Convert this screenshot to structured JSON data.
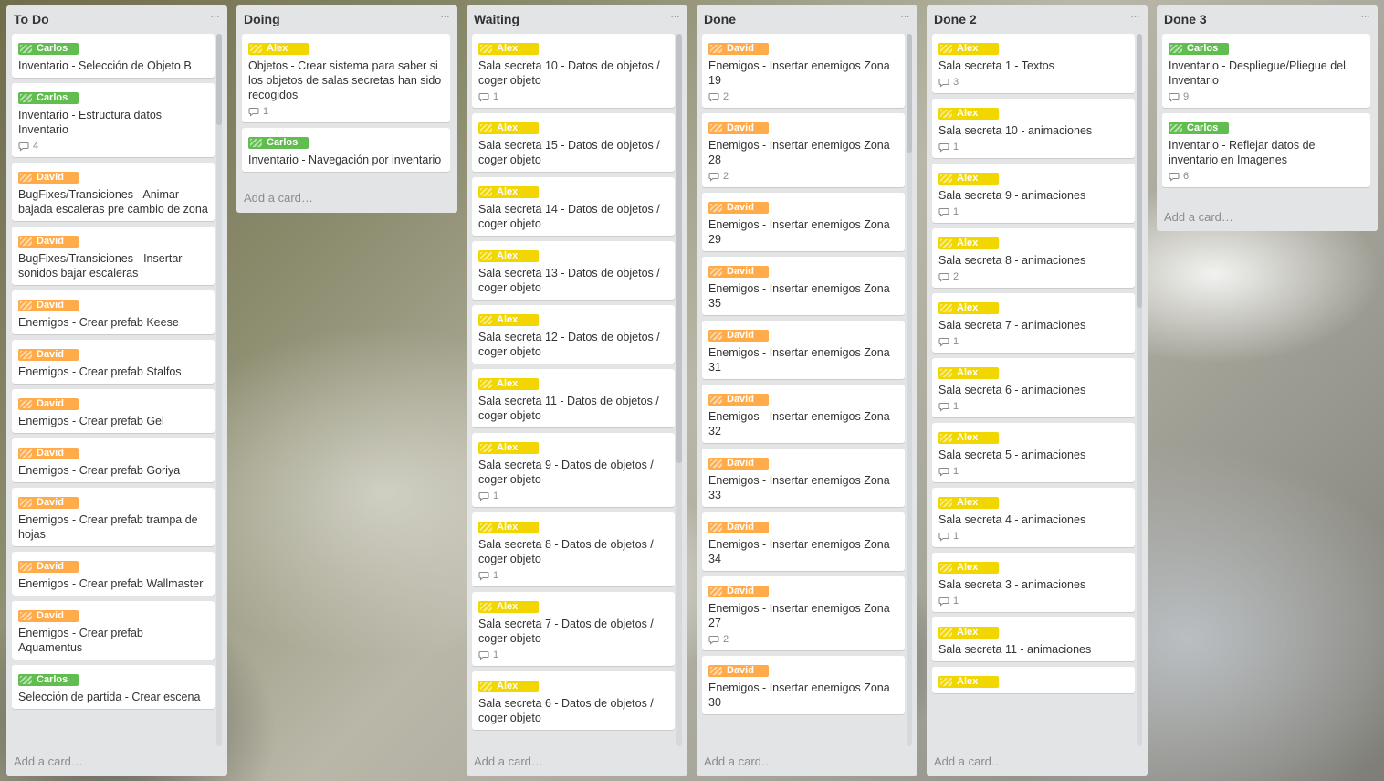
{
  "lists": [
    {
      "title": "To Do",
      "menu": "···",
      "add": "Add a card…",
      "cards": [
        {
          "label": "Carlos",
          "color": "green",
          "title": "Inventario - Selección de Objeto B"
        },
        {
          "label": "Carlos",
          "color": "green",
          "title": "Inventario - Estructura datos Inventario",
          "comments": "4"
        },
        {
          "label": "David",
          "color": "orange",
          "title": "BugFixes/Transiciones - Animar bajada escaleras pre cambio de zona"
        },
        {
          "label": "David",
          "color": "orange",
          "title": "BugFixes/Transiciones - Insertar sonidos bajar escaleras"
        },
        {
          "label": "David",
          "color": "orange",
          "title": "Enemigos - Crear prefab Keese"
        },
        {
          "label": "David",
          "color": "orange",
          "title": "Enemigos - Crear prefab Stalfos"
        },
        {
          "label": "David",
          "color": "orange",
          "title": "Enemigos - Crear prefab Gel"
        },
        {
          "label": "David",
          "color": "orange",
          "title": "Enemigos - Crear prefab Goriya"
        },
        {
          "label": "David",
          "color": "orange",
          "title": "Enemigos - Crear prefab trampa de hojas"
        },
        {
          "label": "David",
          "color": "orange",
          "title": "Enemigos - Crear prefab Wallmaster"
        },
        {
          "label": "David",
          "color": "orange",
          "title": "Enemigos - Crear prefab Aquamentus"
        },
        {
          "label": "Carlos",
          "color": "green",
          "title": "Selección de partida - Crear escena"
        }
      ]
    },
    {
      "title": "Doing",
      "menu": "···",
      "add": "Add a card…",
      "cards": [
        {
          "label": "Alex",
          "color": "yellow",
          "title": "Objetos - Crear sistema para saber si los objetos de salas secretas han sido recogidos",
          "comments": "1"
        },
        {
          "label": "Carlos",
          "color": "green",
          "title": "Inventario - Navegación por inventario"
        }
      ]
    },
    {
      "title": "Waiting",
      "menu": "···",
      "add": "Add a card…",
      "cards": [
        {
          "label": "Alex",
          "color": "yellow",
          "title": "Sala secreta 10 - Datos de objetos / coger objeto",
          "comments": "1"
        },
        {
          "label": "Alex",
          "color": "yellow",
          "title": "Sala secreta 15 - Datos de objetos / coger objeto"
        },
        {
          "label": "Alex",
          "color": "yellow",
          "title": "Sala secreta 14 - Datos de objetos / coger objeto"
        },
        {
          "label": "Alex",
          "color": "yellow",
          "title": "Sala secreta 13 - Datos de objetos / coger objeto"
        },
        {
          "label": "Alex",
          "color": "yellow",
          "title": "Sala secreta 12 - Datos de objetos / coger objeto"
        },
        {
          "label": "Alex",
          "color": "yellow",
          "title": "Sala secreta 11 - Datos de objetos / coger objeto"
        },
        {
          "label": "Alex",
          "color": "yellow",
          "title": "Sala secreta 9 - Datos de objetos / coger objeto",
          "comments": "1"
        },
        {
          "label": "Alex",
          "color": "yellow",
          "title": "Sala secreta 8 - Datos de objetos / coger objeto",
          "comments": "1"
        },
        {
          "label": "Alex",
          "color": "yellow",
          "title": "Sala secreta 7 - Datos de objetos / coger objeto",
          "comments": "1"
        },
        {
          "label": "Alex",
          "color": "yellow",
          "title": "Sala secreta 6 - Datos de objetos / coger objeto"
        }
      ]
    },
    {
      "title": "Done",
      "menu": "···",
      "add": "Add a card…",
      "cards": [
        {
          "label": "David",
          "color": "orange",
          "title": "Enemigos - Insertar enemigos Zona 19",
          "comments": "2"
        },
        {
          "label": "David",
          "color": "orange",
          "title": "Enemigos - Insertar enemigos Zona 28",
          "comments": "2"
        },
        {
          "label": "David",
          "color": "orange",
          "title": "Enemigos - Insertar enemigos Zona 29"
        },
        {
          "label": "David",
          "color": "orange",
          "title": "Enemigos - Insertar enemigos Zona 35"
        },
        {
          "label": "David",
          "color": "orange",
          "title": "Enemigos - Insertar enemigos Zona 31"
        },
        {
          "label": "David",
          "color": "orange",
          "title": "Enemigos - Insertar enemigos Zona 32"
        },
        {
          "label": "David",
          "color": "orange",
          "title": "Enemigos - Insertar enemigos Zona 33"
        },
        {
          "label": "David",
          "color": "orange",
          "title": "Enemigos - Insertar enemigos Zona 34"
        },
        {
          "label": "David",
          "color": "orange",
          "title": "Enemigos - Insertar enemigos Zona 27",
          "comments": "2"
        },
        {
          "label": "David",
          "color": "orange",
          "title": "Enemigos - Insertar enemigos Zona 30"
        }
      ]
    },
    {
      "title": "Done 2",
      "menu": "···",
      "add": "Add a card…",
      "cards": [
        {
          "label": "Alex",
          "color": "yellow",
          "title": "Sala secreta 1 - Textos",
          "comments": "3"
        },
        {
          "label": "Alex",
          "color": "yellow",
          "title": "Sala secreta 10 - animaciones",
          "comments": "1"
        },
        {
          "label": "Alex",
          "color": "yellow",
          "title": "Sala secreta 9 - animaciones",
          "comments": "1"
        },
        {
          "label": "Alex",
          "color": "yellow",
          "title": "Sala secreta 8 - animaciones",
          "comments": "2"
        },
        {
          "label": "Alex",
          "color": "yellow",
          "title": "Sala secreta 7 - animaciones",
          "comments": "1"
        },
        {
          "label": "Alex",
          "color": "yellow",
          "title": "Sala secreta 6 - animaciones",
          "comments": "1"
        },
        {
          "label": "Alex",
          "color": "yellow",
          "title": "Sala secreta 5 - animaciones",
          "comments": "1"
        },
        {
          "label": "Alex",
          "color": "yellow",
          "title": "Sala secreta 4 - animaciones",
          "comments": "1"
        },
        {
          "label": "Alex",
          "color": "yellow",
          "title": "Sala secreta 3 - animaciones",
          "comments": "1"
        },
        {
          "label": "Alex",
          "color": "yellow",
          "title": "Sala secreta 11 - animaciones"
        },
        {
          "label": "Alex",
          "color": "yellow",
          "title": ""
        }
      ]
    },
    {
      "title": "Done 3",
      "menu": "···",
      "add": "Add a card…",
      "cards": [
        {
          "label": "Carlos",
          "color": "green",
          "title": "Inventario - Despliegue/Pliegue del Inventario",
          "comments": "9"
        },
        {
          "label": "Carlos",
          "color": "green",
          "title": "Inventario - Reflejar datos de inventario en Imagenes",
          "comments": "6"
        }
      ]
    }
  ]
}
